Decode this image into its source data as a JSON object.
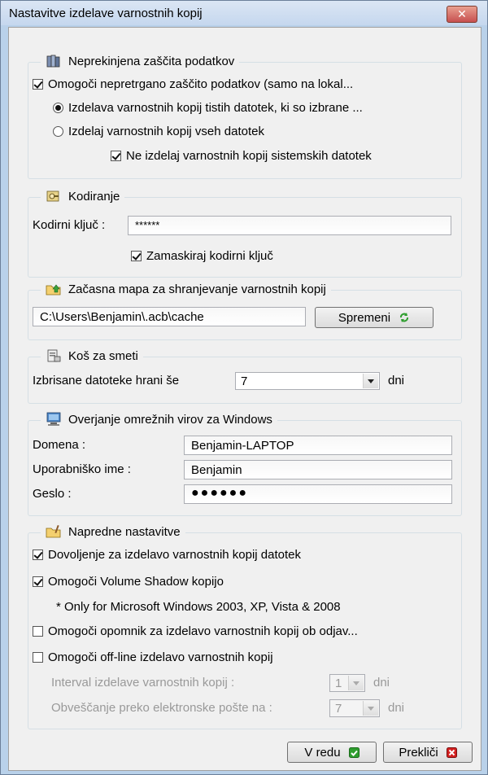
{
  "window": {
    "title": "Nastavitve izdelave varnostnih kopij",
    "close_glyph": "✕"
  },
  "continuous": {
    "title": "Neprekinjena zaščita podatkov",
    "enable_label": "Omogoči nepretrgano zaščito podatkov (samo na lokal...",
    "enable_checked": true,
    "radio_selected_label": "Izdelava varnostnih kopij tistih datotek, ki so izbrane ...",
    "radio_all_label": "Izdelaj varnostnih kopij vseh datotek",
    "exclude_system_label": "Ne izdelaj varnostnih kopij sistemskih datotek",
    "exclude_system_checked": true
  },
  "encryption": {
    "title": "Kodiranje",
    "key_label": "Kodirni ključ :",
    "key_value": "******",
    "mask_label": "Zamaskiraj kodirni ključ",
    "mask_checked": true
  },
  "temp": {
    "title": "Začasna mapa za shranjevanje varnostnih kopij",
    "path": "C:\\Users\\Benjamin\\.acb\\cache",
    "change_label": "Spremeni"
  },
  "recycle": {
    "title": "Koš za smeti",
    "label": "Izbrisane datoteke hrani še",
    "value": "7",
    "unit": "dni"
  },
  "network": {
    "title": "Overjanje omrežnih virov za Windows",
    "domain_label": "Domena :",
    "domain_value": "Benjamin-LAPTOP",
    "user_label": "Uporabniško ime :",
    "user_value": "Benjamin",
    "password_label": "Geslo :",
    "password_value": "●●●●●●"
  },
  "advanced": {
    "title": "Napredne nastavitve",
    "allow_label": "Dovoljenje za izdelavo varnostnih kopij datotek",
    "allow_checked": true,
    "vss_label": "Omogoči Volume Shadow kopijo",
    "vss_checked": true,
    "vss_note": "* Only for Microsoft Windows 2003, XP, Vista & 2008",
    "reminder_label": "Omogoči opomnik za izdelavo varnostnih kopij ob odjav...",
    "offline_label": "Omogoči off-line izdelavo varnostnih kopij",
    "interval_label": "Interval izdelave varnostnih kopij :",
    "interval_value": "1",
    "interval_unit": "dni",
    "email_label": "Obveščanje preko elektronske pošte na :",
    "email_value": "7",
    "email_unit": "dni"
  },
  "buttons": {
    "ok_label": "V redu",
    "cancel_label": "Prekliči"
  },
  "colors": {
    "title_bg": "#c5d7ee",
    "ok_icon": "#2f9e2f",
    "cancel_icon": "#d32020"
  }
}
